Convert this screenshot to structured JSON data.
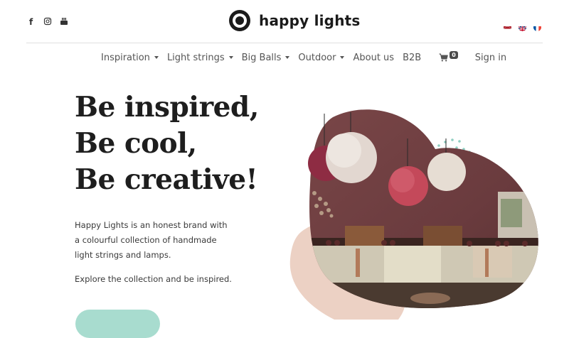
{
  "header": {
    "social": [
      {
        "name": "facebook-icon"
      },
      {
        "name": "instagram-icon"
      },
      {
        "name": "youtube-icon"
      }
    ],
    "brand": "happy lights",
    "flags": [
      {
        "name": "dutch-flag-icon"
      },
      {
        "name": "english-flag-icon"
      },
      {
        "name": "french-flag-icon"
      }
    ]
  },
  "nav": {
    "items": [
      {
        "label": "Inspiration",
        "dropdown": true
      },
      {
        "label": "Light strings",
        "dropdown": true
      },
      {
        "label": "Big Balls",
        "dropdown": true
      },
      {
        "label": "Outdoor",
        "dropdown": true
      },
      {
        "label": "About us",
        "dropdown": false
      },
      {
        "label": "B2B",
        "dropdown": false
      }
    ],
    "cart_count": "0",
    "sign_in": "Sign in"
  },
  "hero": {
    "title_lines": [
      "Be inspired,",
      "Be cool,",
      "Be creative!"
    ],
    "intro": "Happy Lights is an honest brand with a colourful collection of handmade light strings and lamps.",
    "explore": "Explore the collection and be inspired.",
    "image_name": "dining-room-lamps-photo"
  },
  "colors": {
    "accent": "#a8dccf",
    "blob_peach": "#ecd1c4",
    "wall": "#6a3b3e"
  }
}
